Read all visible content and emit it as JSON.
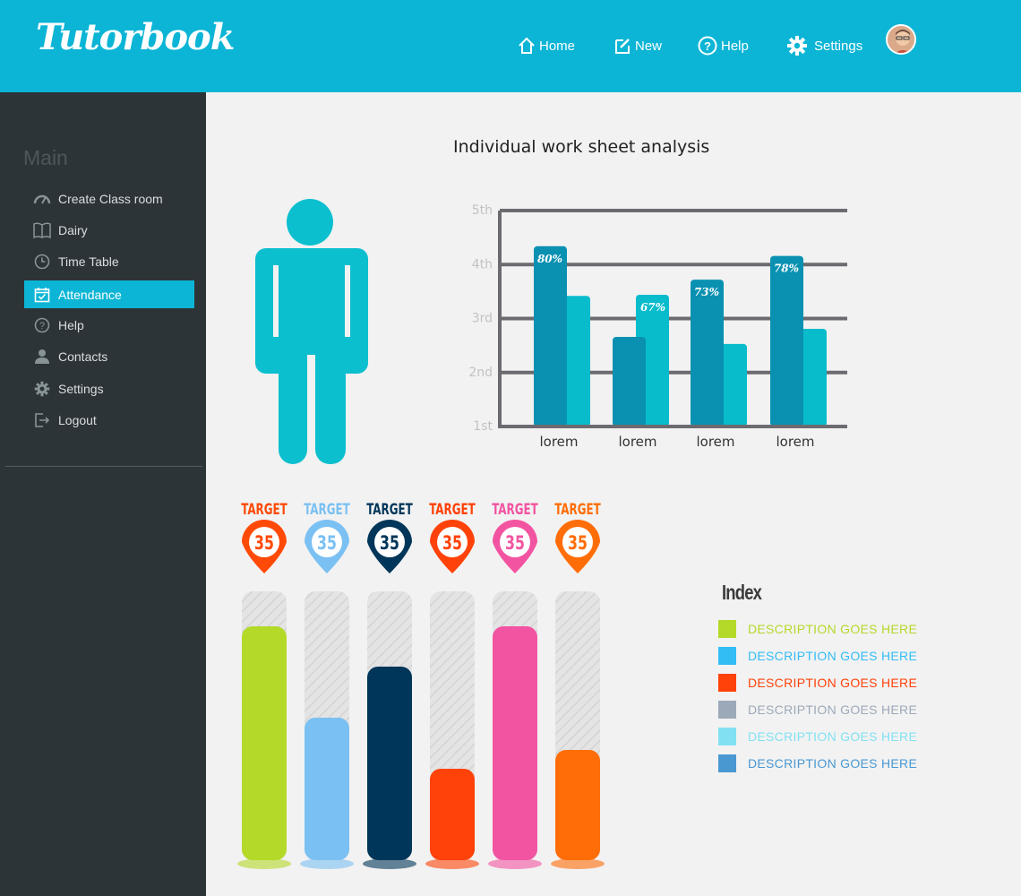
{
  "app": {
    "title": "Tutorbook"
  },
  "nav": {
    "home": "Home",
    "new": "New",
    "help": "Help",
    "settings": "Settings"
  },
  "sidebar": {
    "section_title": "Main",
    "items": [
      {
        "label": "Create Class room",
        "icon": "speedometer-icon"
      },
      {
        "label": "Dairy",
        "icon": "book-icon"
      },
      {
        "label": "Time Table",
        "icon": "clock-icon"
      },
      {
        "label": "Attendance",
        "icon": "calendar-icon",
        "active": true
      },
      {
        "label": "Help",
        "icon": "question-icon"
      },
      {
        "label": "Contacts",
        "icon": "person-icon"
      },
      {
        "label": "Settings",
        "icon": "gear-icon"
      },
      {
        "label": "Logout",
        "icon": "logout-icon"
      }
    ]
  },
  "chart_data": [
    {
      "type": "bar",
      "title": "Individual work sheet analysis",
      "categories": [
        "lorem",
        "lorem",
        "lorem",
        "lorem"
      ],
      "y_tick_labels": [
        "1st",
        "2nd",
        "3rd",
        "4th",
        "5th"
      ],
      "ylim": [
        1,
        5
      ],
      "series": [
        {
          "color": "#0a91b2",
          "values": [
            4.34,
            2.66,
            3.72,
            4.16
          ],
          "labels": [
            "80%",
            "",
            "73%",
            "78%"
          ]
        },
        {
          "color": "#08bccc",
          "values": [
            3.42,
            3.44,
            2.53,
            2.81
          ],
          "labels": [
            "",
            "67%",
            "",
            ""
          ]
        }
      ],
      "grid": true
    },
    {
      "type": "bar",
      "target_label": "TARGET",
      "target_value": "35",
      "values": [
        0.87,
        0.53,
        0.72,
        0.34,
        0.87,
        0.41
      ],
      "colors": [
        "#b4d929",
        "#7bc0f2",
        "#003659",
        "#ff4209",
        "#f254a1",
        "#ff6d08"
      ],
      "marker_colors": [
        "#ff4a07",
        "#7bc0f2",
        "#003659",
        "#ff4209",
        "#f254a1",
        "#ff6d08"
      ]
    }
  ],
  "index": {
    "title": "Index",
    "items": [
      {
        "label": "DESCRIPTION GOES HERE",
        "color": "#b4d929"
      },
      {
        "label": "DESCRIPTION GOES HERE",
        "color": "#33bdf5"
      },
      {
        "label": "DESCRIPTION GOES HERE",
        "color": "#ff4209"
      },
      {
        "label": "DESCRIPTION GOES HERE",
        "color": "#9ca9b8"
      },
      {
        "label": "DESCRIPTION GOES HERE",
        "color": "#81e1f3"
      },
      {
        "label": "DESCRIPTION GOES HERE",
        "color": "#4a98d2"
      }
    ]
  },
  "colors": {
    "accent": "#0cb5d5",
    "sidebar": "#2d3437",
    "figure": "#0cbfcf"
  }
}
